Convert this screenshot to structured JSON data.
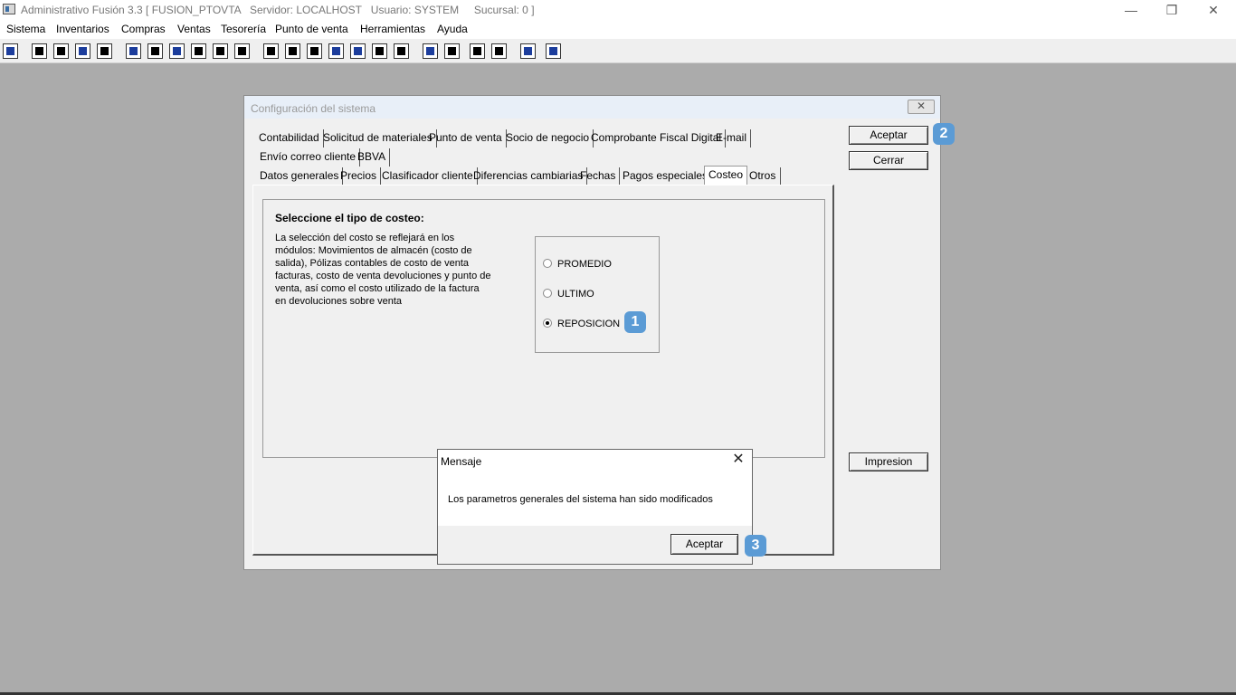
{
  "window": {
    "title": "Administrativo Fusión 3.3 [ FUSION_PTOVTA   Servidor: LOCALHOST   Usuario: SYSTEM     Sucursal: 0 ]",
    "controls": {
      "minimize": "—",
      "restore": "❐",
      "close": "✕"
    }
  },
  "menu": [
    "Sistema",
    "Inventarios",
    "Compras",
    "Ventas",
    "Tesorería",
    "Punto de venta",
    "Herramientas",
    "Ayuda"
  ],
  "toolbar_icon_count": 24,
  "config_dialog": {
    "title": "Configuración del sistema",
    "close_label": "✕",
    "tabs_row1": [
      "Contabilidad",
      "Solicitud de materiales",
      "Punto de venta",
      "Socio de negocio",
      "Comprobante Fiscal Digital",
      "E-mail"
    ],
    "tabs_row2": [
      "Envío correo cliente",
      "BBVA"
    ],
    "tabs_row3": [
      "Datos generales",
      "Precios",
      "Clasificador cliente",
      "Diferencias cambiarias",
      "Fechas",
      "Pagos especiales",
      "Costeo",
      "Otros"
    ],
    "selected_tab": "Costeo",
    "section_title": "Seleccione el tipo de costeo:",
    "section_description": "La selección del costo se reflejará en los módulos: Movimientos de almacén (costo de salida), Pólizas contables de costo de venta facturas, costo de venta devoluciones y punto de venta, así como el costo utilizado de la factura en devoluciones sobre venta",
    "options": [
      {
        "label": "PROMEDIO",
        "selected": false
      },
      {
        "label": "ULTIMO",
        "selected": false
      },
      {
        "label": "REPOSICION",
        "selected": true
      }
    ],
    "buttons": {
      "accept": "Aceptar",
      "close": "Cerrar",
      "print": "Impresion"
    }
  },
  "badges": [
    "1",
    "2",
    "3"
  ],
  "message_dialog": {
    "title": "Mensaje",
    "close_label": "✕",
    "text": "Los parametros generales del sistema han sido modificados",
    "ok_label": "Aceptar"
  },
  "colors": {
    "badge": "#5b9bd5",
    "workspace": "#ababab",
    "dialog": "#f0f0f0"
  }
}
